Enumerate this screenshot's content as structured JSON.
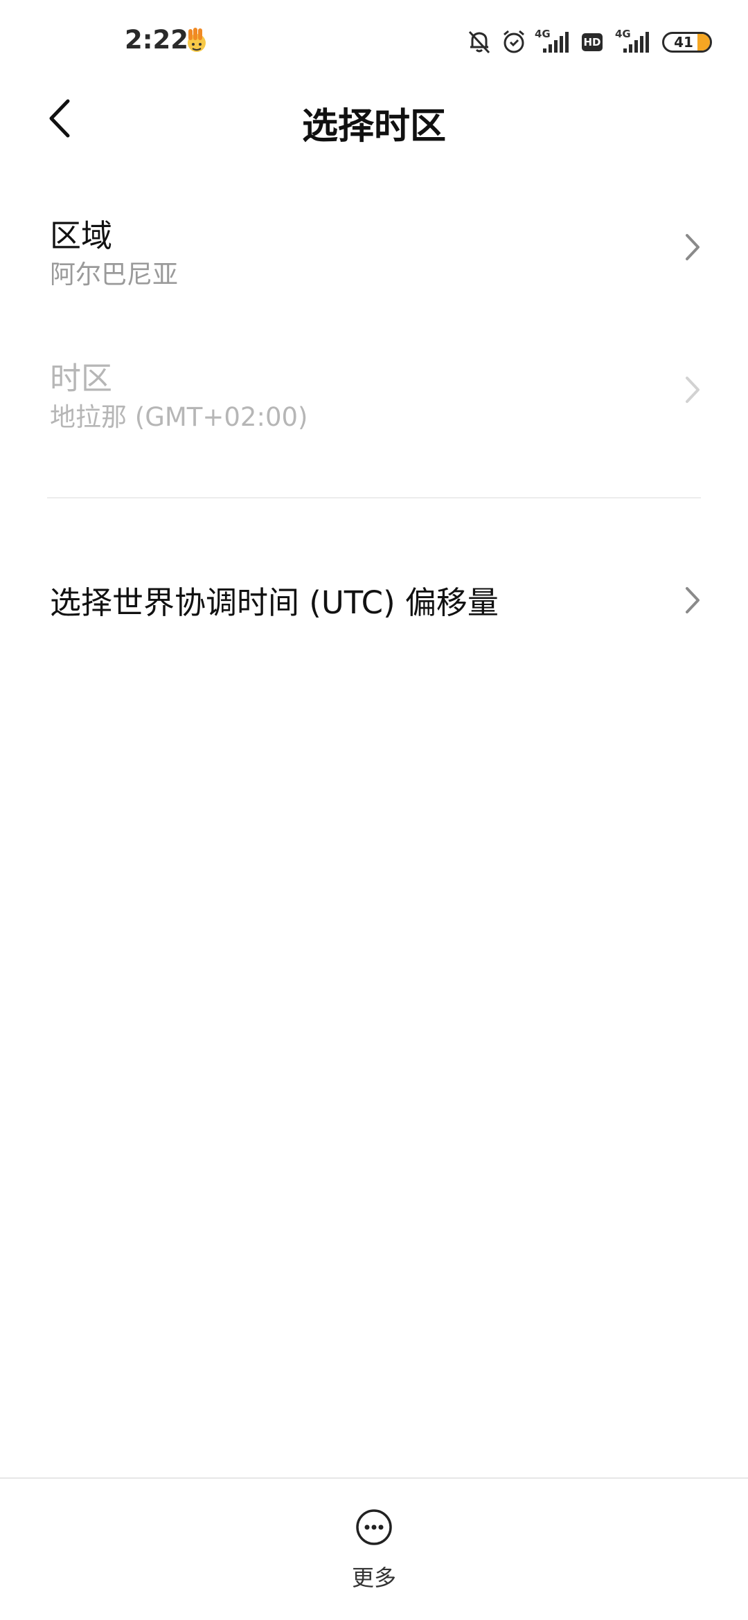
{
  "status_bar": {
    "time": "2:22",
    "net1": "4G",
    "hd": "HD",
    "net2": "4G",
    "battery": "41"
  },
  "header": {
    "title": "选择时区"
  },
  "rows": {
    "region": {
      "title": "区域",
      "value": "阿尔巴尼亚"
    },
    "timezone": {
      "title": "时区",
      "value": "地拉那 (GMT+02:00)"
    },
    "utc_offset": {
      "title": "选择世界协调时间 (UTC) 偏移量"
    }
  },
  "footer": {
    "more_label": "更多"
  },
  "colors": {
    "accent_battery": "#f5a623",
    "text_primary": "#111111",
    "text_secondary": "#9a9a9a",
    "text_disabled": "#b6b6b6"
  }
}
